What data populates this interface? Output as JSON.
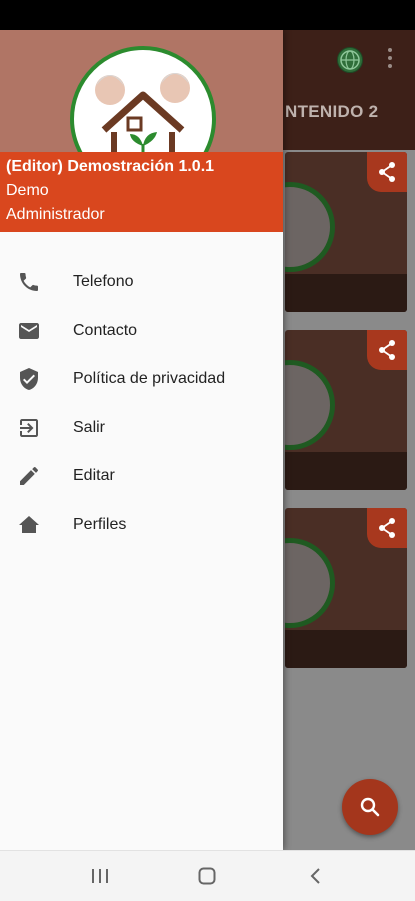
{
  "app": {
    "tab2_label": "NTENIDO 2"
  },
  "drawer": {
    "header": {
      "title": "(Editor) Demostración 1.0.1",
      "user": "Demo",
      "role": "Administrador"
    },
    "items": [
      {
        "label": "Telefono",
        "icon": "phone-icon"
      },
      {
        "label": "Contacto",
        "icon": "mail-icon"
      },
      {
        "label": "Política de privacidad",
        "icon": "shield-icon"
      },
      {
        "label": "Salir",
        "icon": "exit-icon"
      },
      {
        "label": "Editar",
        "icon": "pencil-icon"
      },
      {
        "label": "Perfiles",
        "icon": "home-icon"
      }
    ]
  },
  "colors": {
    "accent": "#d9471e",
    "logo_ring": "#2c8b2e",
    "appbar": "#3d2018"
  }
}
